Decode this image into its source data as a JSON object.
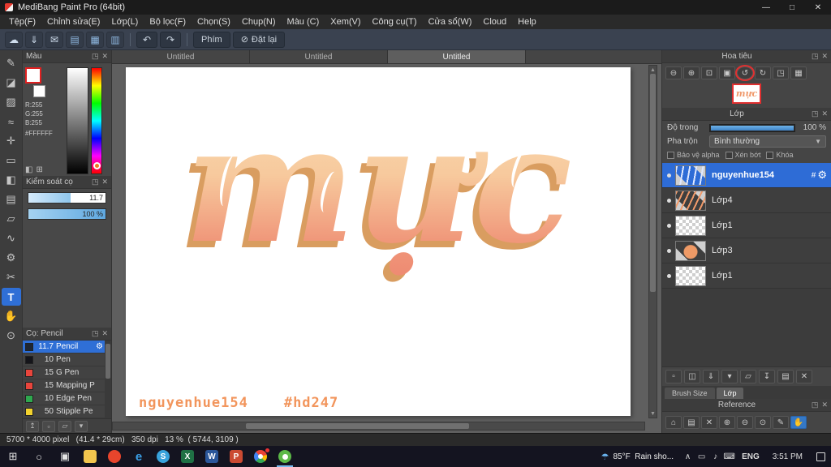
{
  "window": {
    "title": "MediBang Paint Pro (64bit)",
    "minimize": "—",
    "maximize": "□",
    "close": "✕"
  },
  "menubar": {
    "items": [
      "Tệp(F)",
      "Chỉnh sửa(E)",
      "Lớp(L)",
      "Bộ lọc(F)",
      "Chọn(S)",
      "Chụp(N)",
      "Màu (C)",
      "Xem(V)",
      "Công cụ(T)",
      "Cửa sổ(W)",
      "Cloud",
      "Help"
    ]
  },
  "toolbar": {
    "icons": [
      {
        "name": "cloud",
        "glyph": "☁"
      },
      {
        "name": "save",
        "glyph": "⇓"
      },
      {
        "name": "comment",
        "glyph": "✉"
      },
      {
        "name": "layout-left",
        "glyph": "▤"
      },
      {
        "name": "layout-grid",
        "glyph": "▦"
      },
      {
        "name": "layout-right",
        "glyph": "▥"
      }
    ],
    "undo": "↶",
    "redo": "↷",
    "keys_button": "Phím",
    "reset_button": "Đặt lại",
    "reset_icon": "⊘"
  },
  "tools": {
    "items": [
      {
        "name": "brush",
        "glyph": "✎"
      },
      {
        "name": "eraser",
        "glyph": "◪"
      },
      {
        "name": "pattern",
        "glyph": "▨"
      },
      {
        "name": "smudge",
        "glyph": "≈"
      },
      {
        "name": "move",
        "glyph": "✛"
      },
      {
        "name": "shape",
        "glyph": "▭"
      },
      {
        "name": "bucket",
        "glyph": "◧"
      },
      {
        "name": "gradient",
        "glyph": "▤"
      },
      {
        "name": "marquee",
        "glyph": "▱"
      },
      {
        "name": "lasso",
        "glyph": "∿"
      },
      {
        "name": "operation",
        "glyph": "⚙"
      },
      {
        "name": "divide",
        "glyph": "✂"
      },
      {
        "name": "text",
        "glyph": "T"
      },
      {
        "name": "hand",
        "glyph": "✋"
      },
      {
        "name": "eyedropper",
        "glyph": "⊙"
      }
    ]
  },
  "color_panel": {
    "title": "Màu",
    "r": "R:255",
    "g": "G:255",
    "b": "B:255",
    "hex": "#FFFFFF",
    "picker_color": "#f07820"
  },
  "brush_control": {
    "title": "Kiểm soát cọ",
    "size_value": "11.7",
    "opacity_value": "100 %"
  },
  "brush_panel": {
    "title": "Cọ: Pencil",
    "gear_icon": "⚙",
    "brushes": [
      {
        "size": "11.7",
        "name": "Pencil",
        "color": "#1e2633"
      },
      {
        "size": "10",
        "name": "Pen",
        "color": "#15151a"
      },
      {
        "size": "15",
        "name": "G Pen",
        "color": "#e8453c"
      },
      {
        "size": "15",
        "name": "Mapping P",
        "color": "#e8453c"
      },
      {
        "size": "10",
        "name": "Edge Pen",
        "color": "#2fa84f"
      },
      {
        "size": "50",
        "name": "Stipple Pe",
        "color": "#f2d22e"
      }
    ],
    "bottom_icons": [
      {
        "name": "move-up",
        "glyph": "↥"
      },
      {
        "name": "add-brush",
        "glyph": "▫"
      },
      {
        "name": "brush-folder",
        "glyph": "▱"
      },
      {
        "name": "brush-menu",
        "glyph": "▾"
      }
    ]
  },
  "canvas": {
    "tabs": [
      "Untitled",
      "Untitled",
      "Untitled"
    ],
    "artwork_text": "mực",
    "signature": "nguyenhue154",
    "tag": "#hd247",
    "accent_color": "#f2955c"
  },
  "navigator": {
    "title": "Hoa tiêu",
    "zoom_icons": [
      {
        "name": "zoom-out",
        "glyph": "⊖"
      },
      {
        "name": "zoom-in",
        "glyph": "⊕"
      },
      {
        "name": "zoom-fit",
        "glyph": "⊡"
      },
      {
        "name": "zoom-actual",
        "glyph": "▣"
      },
      {
        "name": "rotate-reset",
        "glyph": "↺"
      },
      {
        "name": "rotate",
        "glyph": "↻"
      },
      {
        "name": "flip",
        "glyph": "◳"
      },
      {
        "name": "grid",
        "glyph": "▦"
      }
    ]
  },
  "layers_panel": {
    "title": "Lớp",
    "opacity_label": "Độ trong",
    "opacity_value": "100 %",
    "blend_label": "Pha trộn",
    "blend_value": "Bình thường",
    "check_alpha": "Bảo vệ alpha",
    "check_clip": "Xén bớt",
    "check_lock": "Khóa",
    "gear_icon": "⚙",
    "layers": [
      {
        "name": "nguyenhue154",
        "badge": "#"
      },
      {
        "name": "Lớp4"
      },
      {
        "name": "Lớp1"
      },
      {
        "name": "Lớp3"
      },
      {
        "name": "Lớp1"
      }
    ],
    "buttons": [
      {
        "name": "new-layer",
        "glyph": "▫"
      },
      {
        "name": "duplicate-layer",
        "glyph": "◫"
      },
      {
        "name": "layer-transfer",
        "glyph": "⇓"
      },
      {
        "name": "new-folder",
        "glyph": "▾"
      },
      {
        "name": "folder",
        "glyph": "▱"
      },
      {
        "name": "merge-down",
        "glyph": "↧"
      },
      {
        "name": "clear-layer",
        "glyph": "▤"
      },
      {
        "name": "delete-layer",
        "glyph": "✕"
      }
    ],
    "tab_brush_size": "Brush Size",
    "tab_layer": "Lớp"
  },
  "reference_panel": {
    "title": "Reference",
    "icons": [
      {
        "name": "home",
        "glyph": "⌂"
      },
      {
        "name": "open-folder",
        "glyph": "▤"
      },
      {
        "name": "close-image",
        "glyph": "✕"
      },
      {
        "name": "zoom-in",
        "glyph": "⊕"
      },
      {
        "name": "zoom-out",
        "glyph": "⊖"
      },
      {
        "name": "zoom-reset",
        "glyph": "⊙"
      },
      {
        "name": "pick",
        "glyph": "✎"
      },
      {
        "name": "hand",
        "glyph": "✋"
      }
    ]
  },
  "statusbar": {
    "text": "5700 * 4000 pixel   (41.4 * 29cm)   350 dpi   13 %  ( 5744, 3109 )"
  },
  "taskbar": {
    "start": "⊞",
    "search": "○",
    "task_view": "▣",
    "apps": [
      {
        "name": "file-explorer",
        "letter": "",
        "color": "#f3c64e"
      },
      {
        "name": "firefox",
        "letter": "",
        "color": "#e8452c"
      },
      {
        "name": "edge",
        "letter": "e",
        "color": "transparent"
      },
      {
        "name": "skype",
        "letter": "S",
        "color": "#38a3dc"
      },
      {
        "name": "excel",
        "letter": "X",
        "color": "#1f7145"
      },
      {
        "name": "word",
        "letter": "W",
        "color": "#2b579a"
      },
      {
        "name": "powerpoint",
        "letter": "P",
        "color": "#cb4a32"
      },
      {
        "name": "chrome",
        "letter": "",
        "color": ""
      },
      {
        "name": "medibang",
        "letter": "",
        "color": "#5cb947"
      }
    ],
    "tray_icons": [
      {
        "name": "show-hidden-icons",
        "glyph": "∧"
      },
      {
        "name": "display",
        "glyph": "▭"
      },
      {
        "name": "volume",
        "glyph": "♪"
      },
      {
        "name": "keyboard",
        "glyph": "⌨"
      }
    ],
    "weather": "85°F  Rain sho...",
    "language": "ENG",
    "time": "3:51 PM"
  }
}
